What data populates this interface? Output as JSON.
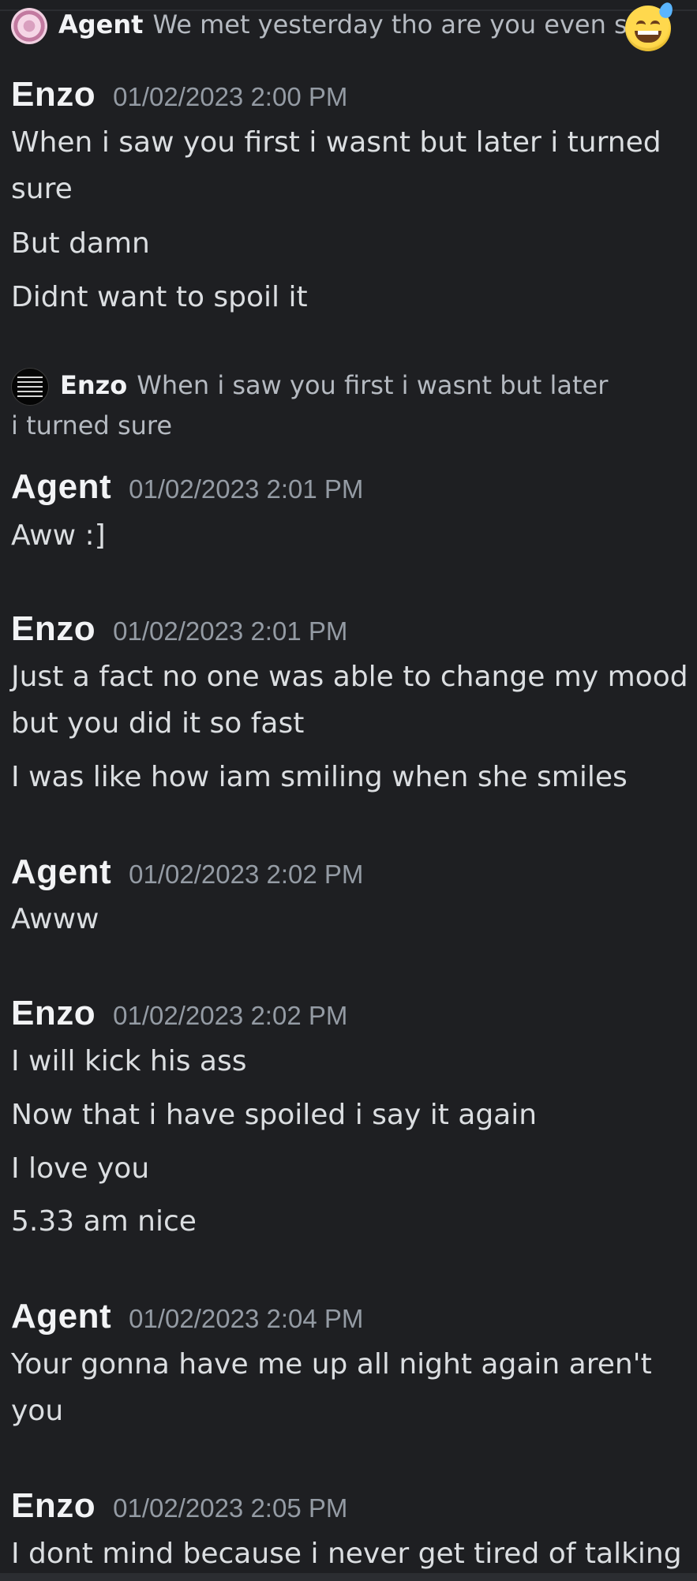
{
  "reply_top": {
    "author": "Agent",
    "text": "We met yesterday tho are you even sure"
  },
  "reply_mid": {
    "author": "Enzo",
    "text": "When i saw you first i wasnt but later i turned sure"
  },
  "messages": [
    {
      "author": "Enzo",
      "time": "01/02/2023 2:00 PM",
      "lines": [
        "When i saw you first i wasnt but later i turned sure",
        "But damn",
        "Didnt want to spoil it"
      ]
    },
    {
      "author": "Agent",
      "time": "01/02/2023 2:01 PM",
      "lines": [
        "Aww :]"
      ]
    },
    {
      "author": "Enzo",
      "time": "01/02/2023 2:01 PM",
      "lines": [
        "Just a fact no one was able to change my mood but you did it so fast",
        "I was like how iam smiling when she smiles"
      ]
    },
    {
      "author": "Agent",
      "time": "01/02/2023 2:02 PM",
      "lines": [
        "Awww"
      ]
    },
    {
      "author": "Enzo",
      "time": "01/02/2023 2:02 PM",
      "lines": [
        "I will kick his ass",
        "Now that i have spoiled i say it again",
        "I love you",
        "5.33 am nice"
      ]
    },
    {
      "author": "Agent",
      "time": "01/02/2023 2:04 PM",
      "lines": [
        "Your gonna have me up all night again aren't you"
      ]
    },
    {
      "author": "Enzo",
      "time": "01/02/2023 2:05 PM",
      "lines": [
        "I dont mind because i never get tired of talking"
      ]
    }
  ],
  "icons": {
    "agent_avatar": "agent-avatar",
    "enzo_avatar": "enzo-avatar",
    "emoji": "grinning-sweat-emoji"
  },
  "colors": {
    "background": "#1e1f22",
    "text": "#dbdee1",
    "author": "#f2f3f5",
    "timestamp": "#949ba4"
  }
}
